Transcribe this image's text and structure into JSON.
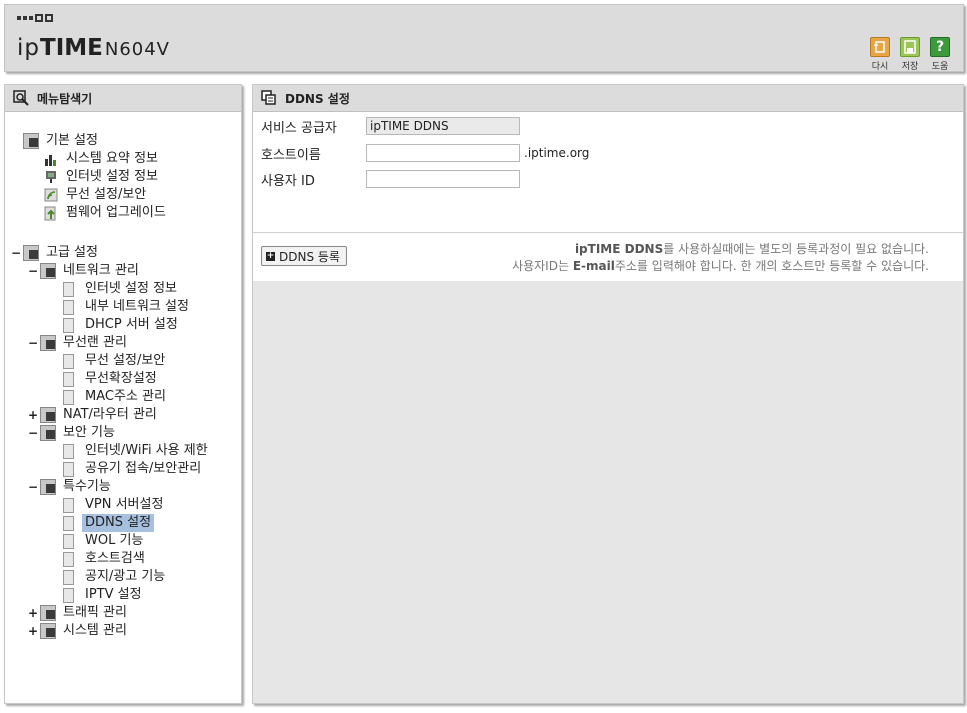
{
  "header": {
    "brand_ip": "ip",
    "brand_time": "TIME",
    "model": "N604V",
    "buttons": {
      "back": "다시",
      "save": "저장",
      "help": "도움"
    }
  },
  "sidebar": {
    "title": "메뉴탐색기",
    "items": [
      {
        "label": "기본 설정",
        "toggle": "",
        "icon": "folder-settings-icon"
      },
      {
        "label": "시스템 요약 정보",
        "icon": "chart-icon"
      },
      {
        "label": "인터넷 설정 정보",
        "icon": "network-icon"
      },
      {
        "label": "무선 설정/보안",
        "icon": "wireless-icon"
      },
      {
        "label": "펌웨어 업그레이드",
        "icon": "upgrade-icon"
      },
      {
        "label": "고급 설정",
        "toggle": "−",
        "icon": "folder-advanced-icon"
      },
      {
        "label": "네트워크 관리",
        "toggle": "−",
        "icon": "network-folder-icon"
      },
      {
        "label": "인터넷 설정 정보",
        "icon": "doc-icon"
      },
      {
        "label": "내부 네트워크 설정",
        "icon": "doc-icon"
      },
      {
        "label": "DHCP 서버 설정",
        "icon": "doc-icon"
      },
      {
        "label": "무선랜 관리",
        "toggle": "−",
        "icon": "wireless-folder-icon"
      },
      {
        "label": "무선 설정/보안",
        "icon": "doc-icon"
      },
      {
        "label": "무선확장설정",
        "icon": "doc-icon"
      },
      {
        "label": "MAC주소 관리",
        "icon": "doc-icon"
      },
      {
        "label": "NAT/라우터 관리",
        "toggle": "+",
        "icon": "router-folder-icon"
      },
      {
        "label": "보안 기능",
        "toggle": "−",
        "icon": "lock-folder-icon"
      },
      {
        "label": "인터넷/WiFi 사용 제한",
        "icon": "doc-icon"
      },
      {
        "label": "공유기 접속/보안관리",
        "icon": "doc-icon"
      },
      {
        "label": "특수기능",
        "toggle": "−",
        "icon": "special-folder-icon"
      },
      {
        "label": "VPN 서버설정",
        "icon": "doc-icon"
      },
      {
        "label": "DDNS 설정",
        "icon": "doc-icon",
        "selected": true
      },
      {
        "label": "WOL 기능",
        "icon": "doc-icon"
      },
      {
        "label": "호스트검색",
        "icon": "doc-icon"
      },
      {
        "label": "공지/광고 기능",
        "icon": "doc-icon"
      },
      {
        "label": "IPTV 설정",
        "icon": "doc-icon"
      },
      {
        "label": "트래픽 관리",
        "toggle": "+",
        "icon": "traffic-folder-icon"
      },
      {
        "label": "시스템 관리",
        "toggle": "+",
        "icon": "system-folder-icon"
      }
    ]
  },
  "main": {
    "title": "DDNS 설정",
    "fields": {
      "provider_label": "서비스 공급자",
      "provider_value": "ipTIME DDNS",
      "hostname_label": "호스트이름",
      "hostname_value": "",
      "hostname_suffix": ".iptime.org",
      "userid_label": "사용자 ID",
      "userid_value": ""
    },
    "register_button": "DDNS 등록",
    "notice_line1_bold": "ipTIME DDNS",
    "notice_line1_rest": "를 사용하실때에는 별도의 등록과정이 필요 없습니다.",
    "notice_line2_a": "사용자ID는 ",
    "notice_line2_bold": "E-mail",
    "notice_line2_b": "주소를 입력해야 합니다. 한 개의 호스트만 등록할 수 있습니다."
  }
}
